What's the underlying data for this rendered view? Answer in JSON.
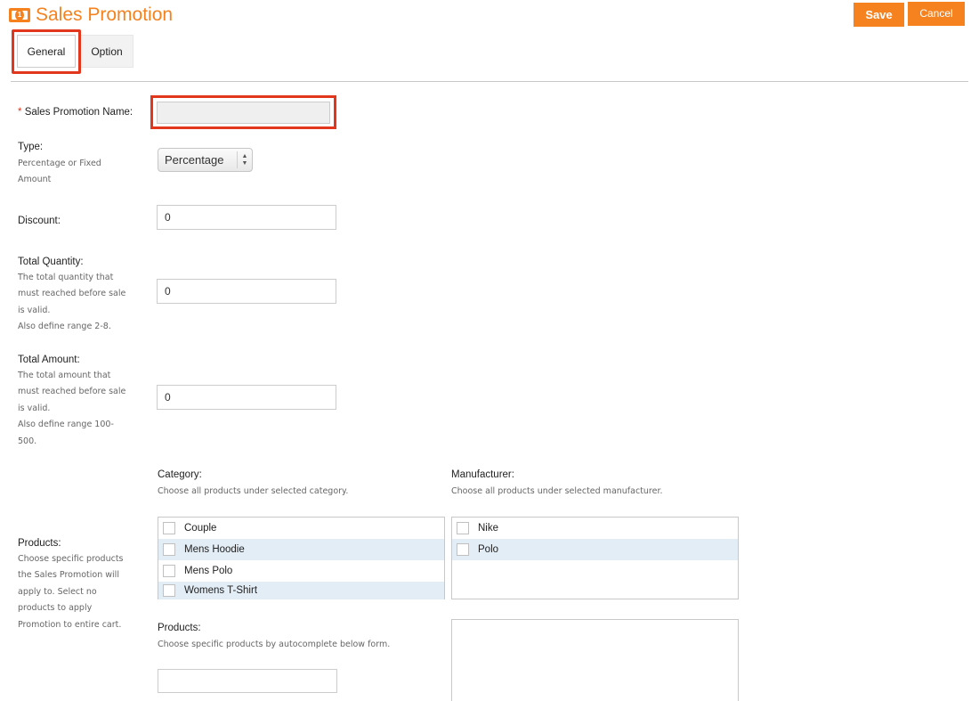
{
  "header": {
    "title": "Sales Promotion",
    "icon": "money-bill-icon",
    "save_label": "Save",
    "cancel_label": "Cancel"
  },
  "tabs": [
    {
      "label": "General",
      "active": true
    },
    {
      "label": "Option",
      "active": false
    }
  ],
  "form": {
    "name": {
      "required_mark": "*",
      "label": "Sales Promotion Name:",
      "value": ""
    },
    "type": {
      "label": "Type:",
      "hint_lines": [
        "Percentage or Fixed",
        "Amount"
      ],
      "selected": "Percentage"
    },
    "discount": {
      "label": "Discount:",
      "value": "0"
    },
    "total_quantity": {
      "label": "Total Quantity:",
      "hint_lines": [
        "The total quantity that",
        "must reached before sale",
        "is valid.",
        "Also define range 2-8."
      ],
      "value": "0"
    },
    "total_amount": {
      "label": "Total Amount:",
      "hint_lines": [
        "The total amount that",
        "must reached before sale",
        "is valid.",
        "Also define range 100-",
        "500."
      ],
      "value": "0"
    },
    "products": {
      "label": "Products:",
      "hint_lines": [
        "Choose specific products",
        "the Sales Promotion will",
        "apply to. Select no",
        "products to apply",
        "Promotion to entire cart."
      ],
      "category": {
        "label": "Category:",
        "hint": "Choose all products under selected category.",
        "items": [
          {
            "label": "Couple",
            "checked": false
          },
          {
            "label": "Mens Hoodie",
            "checked": false
          },
          {
            "label": "Mens Polo",
            "checked": false
          },
          {
            "label": "Womens T-Shirt",
            "checked": false
          }
        ]
      },
      "manufacturer": {
        "label": "Manufacturer:",
        "hint": "Choose all products under selected manufacturer.",
        "items": [
          {
            "label": "Nike",
            "checked": false
          },
          {
            "label": "Polo",
            "checked": false
          }
        ]
      },
      "specific": {
        "label": "Products:",
        "hint": "Choose specific products by autocomplete below form.",
        "value": ""
      }
    }
  },
  "colors": {
    "accent": "#f5821f",
    "highlight": "#e2361d",
    "row_alt": "#e3edf6"
  }
}
